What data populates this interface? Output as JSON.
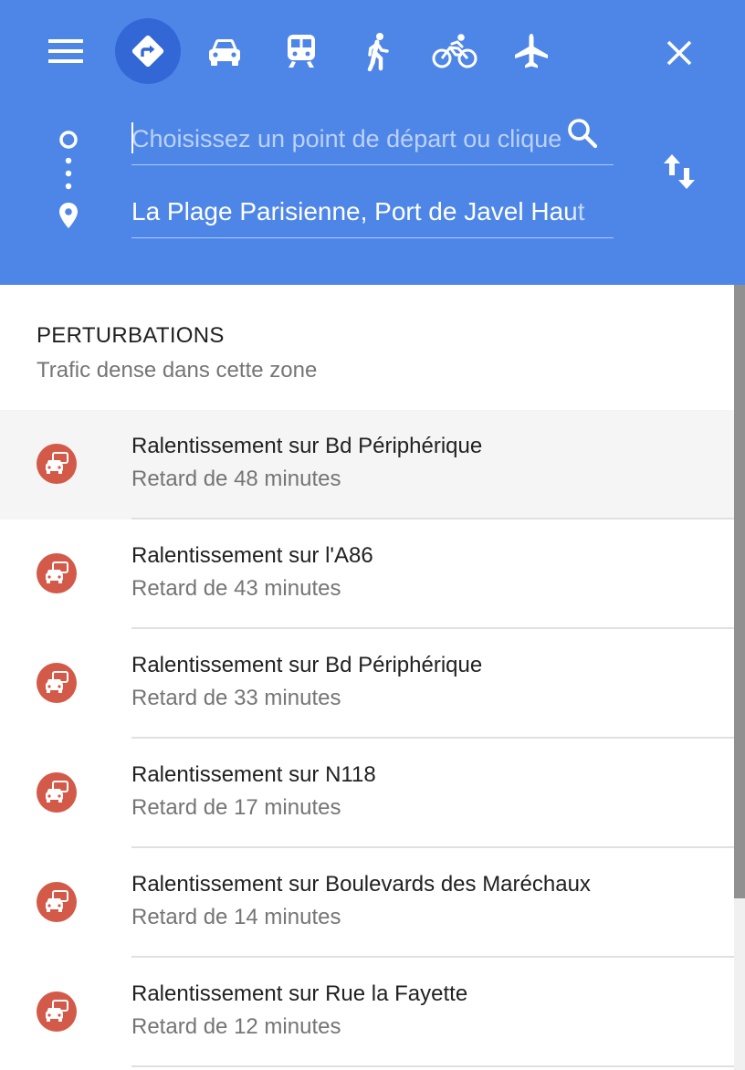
{
  "header": {
    "menu_icon": "hamburger-menu-icon",
    "modes": [
      {
        "name": "directions-mode",
        "icon": "directions-icon",
        "active": true
      },
      {
        "name": "driving-mode",
        "icon": "car-icon",
        "active": false
      },
      {
        "name": "transit-mode",
        "icon": "train-icon",
        "active": false
      },
      {
        "name": "walking-mode",
        "icon": "walking-icon",
        "active": false
      },
      {
        "name": "cycling-mode",
        "icon": "bicycle-icon",
        "active": false
      },
      {
        "name": "flight-mode",
        "icon": "airplane-icon",
        "active": false
      }
    ],
    "close_icon": "close-icon",
    "swap_icon": "swap-directions-icon"
  },
  "route": {
    "start": {
      "value": "",
      "placeholder": "Choisissez un point de départ ou cliquez"
    },
    "destination": {
      "value": "La Plage Parisienne, Port de Javel Haut"
    }
  },
  "disruptions": {
    "title": "PERTURBATIONS",
    "subtitle": "Trafic dense dans cette zone",
    "items": [
      {
        "title": "Ralentissement sur Bd Périphérique",
        "delay": "Retard de 48 minutes"
      },
      {
        "title": "Ralentissement sur l'A86",
        "delay": "Retard de 43 minutes"
      },
      {
        "title": "Ralentissement sur Bd Périphérique",
        "delay": "Retard de 33 minutes"
      },
      {
        "title": "Ralentissement sur N118",
        "delay": "Retard de 17 minutes"
      },
      {
        "title": "Ralentissement sur Boulevards des Maréchaux",
        "delay": "Retard de 14 minutes"
      },
      {
        "title": "Ralentissement sur Rue la Fayette",
        "delay": "Retard de 12 minutes"
      }
    ]
  },
  "colors": {
    "header": "#4e86e8",
    "active_mode": "#3367d6",
    "traffic_badge": "#d35a48"
  }
}
